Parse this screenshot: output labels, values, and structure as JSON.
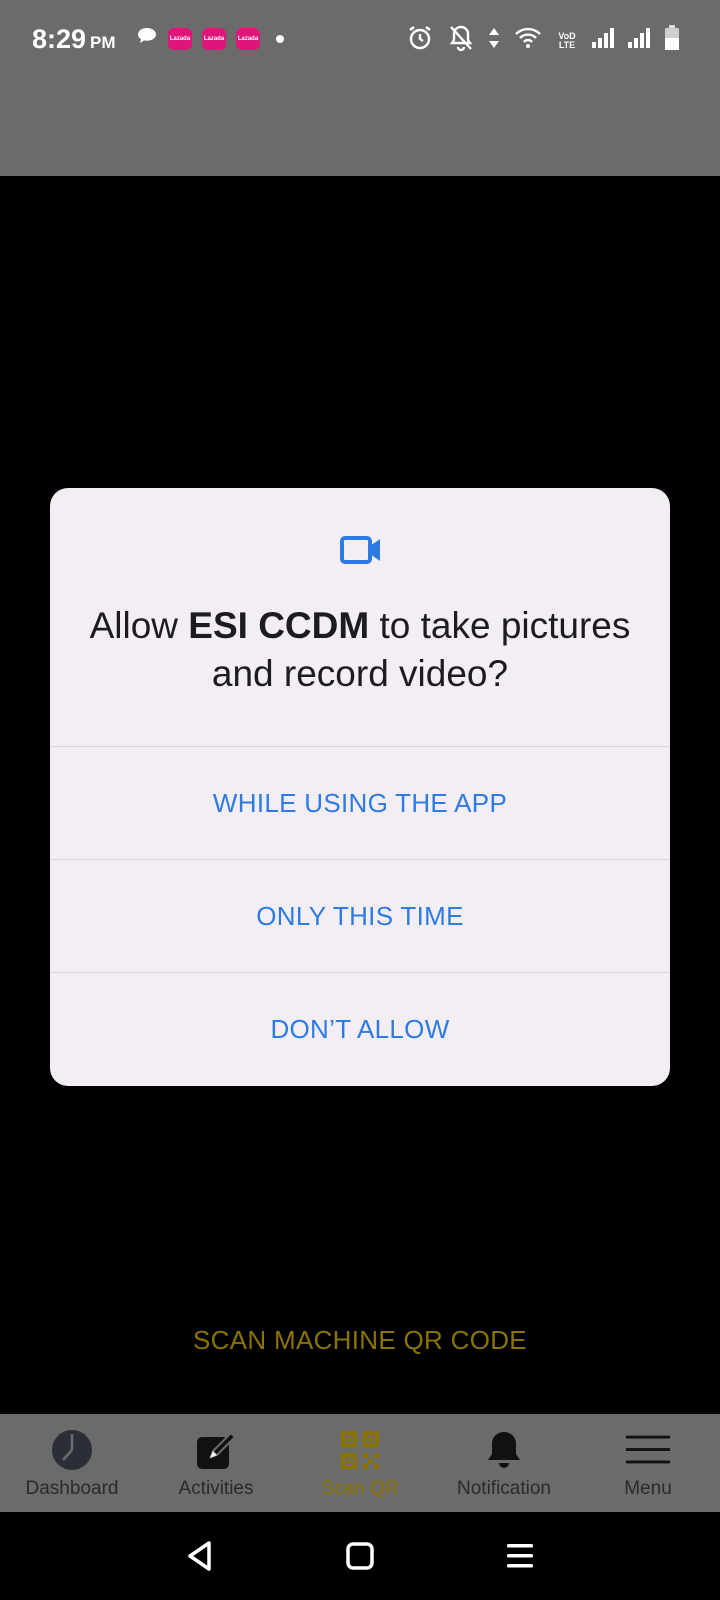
{
  "status_bar": {
    "time": "8:29",
    "ampm": "PM",
    "left_icons": [
      "chat-bubble-icon",
      "app-badge-icon",
      "app-badge-icon",
      "app-badge-icon",
      "dot-icon"
    ],
    "app_badge_text": "Lazada",
    "right_icons": [
      "alarm-icon",
      "bell-off-icon",
      "data-arrows-icon",
      "wifi-icon",
      "volte-icon",
      "signal-icon",
      "signal-icon",
      "battery-icon"
    ],
    "volte_text": "VoD LTE"
  },
  "dialog": {
    "icon": "video-camera-icon",
    "title_prefix": "Allow ",
    "app_name": "ESI CCDM",
    "title_suffix": " to take pictures and record video?",
    "options": [
      {
        "label": "WHILE USING THE APP"
      },
      {
        "label": "ONLY THIS TIME"
      },
      {
        "label": "DON’T ALLOW"
      }
    ]
  },
  "scan_label": "SCAN MACHINE QR CODE",
  "bottom_nav": {
    "items": [
      {
        "label": "Dashboard",
        "icon": "pie-chart-icon"
      },
      {
        "label": "Activities",
        "icon": "edit-icon"
      },
      {
        "label": "Scan QR",
        "icon": "qr-code-icon",
        "active": true
      },
      {
        "label": "Notification",
        "icon": "bell-icon"
      },
      {
        "label": "Menu",
        "icon": "hamburger-menu-icon"
      }
    ]
  },
  "colors": {
    "accent_blue": "#2f7be6",
    "accent_gold": "#8a7300",
    "dialog_bg": "#f2eef3",
    "bar_gray": "#6b6b6b"
  }
}
